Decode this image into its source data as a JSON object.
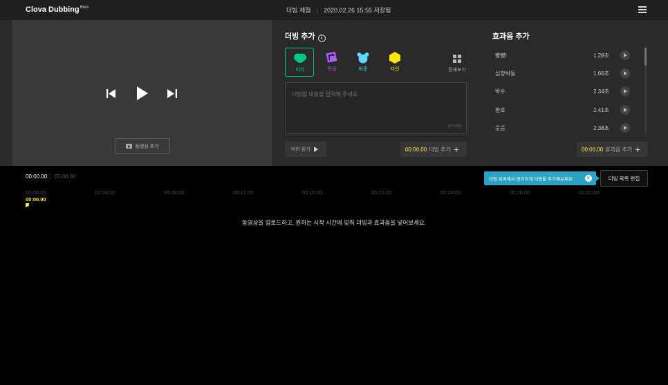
{
  "app": {
    "brand": "Clova Dubbing",
    "brand_beta": "Beta",
    "mode": "더빙 체험",
    "saved_status": "2020.02.26 15:55  저장됨"
  },
  "video": {
    "add_video_label": "동영상 추가"
  },
  "dubbing": {
    "title": "더빙 추가",
    "voices": [
      {
        "label": "아라",
        "color": "#00c78c"
      },
      {
        "label": "민상",
        "color": "#b05cff"
      },
      {
        "label": "하준",
        "color": "#5fd4ff"
      },
      {
        "label": "다인",
        "color": "#ffe600"
      }
    ],
    "view_all_label": "전체보기",
    "placeholder": "더빙할 내용을 입력해 주세요",
    "char_count": "(0/100)",
    "preview_label": "미리 듣기",
    "time": "00:00.00",
    "add_label": "더빙 추가"
  },
  "sfx": {
    "title": "효과음 추가",
    "items": [
      {
        "name": "빵빵!",
        "duration": "1.28초"
      },
      {
        "name": "심장박동",
        "duration": "1.66초"
      },
      {
        "name": "박수",
        "duration": "2.34초"
      },
      {
        "name": "환호",
        "duration": "2.41초"
      },
      {
        "name": "웃음",
        "duration": "2.38초"
      }
    ],
    "time": "00:00.00",
    "add_label": "효과음 추가"
  },
  "timeline": {
    "current": "00:00.00",
    "total": "05:00.00",
    "tooltip": "더빙 목록에서 편리하게 더빙을 추가해보세요",
    "edit_list_label": "더빙 목록 편집",
    "ticks": [
      "00:00.00",
      "00:04.00",
      "00:08.00",
      "00:12.00",
      "00:16.00",
      "00:20.00",
      "00:24.00",
      "00:28.00",
      "00:32.00"
    ],
    "playhead": "00:00.00",
    "empty_message": "동영상을 업로드하고, 원하는 시작 시간에 맞춰 더빙과 효과음을 넣어보세요."
  }
}
